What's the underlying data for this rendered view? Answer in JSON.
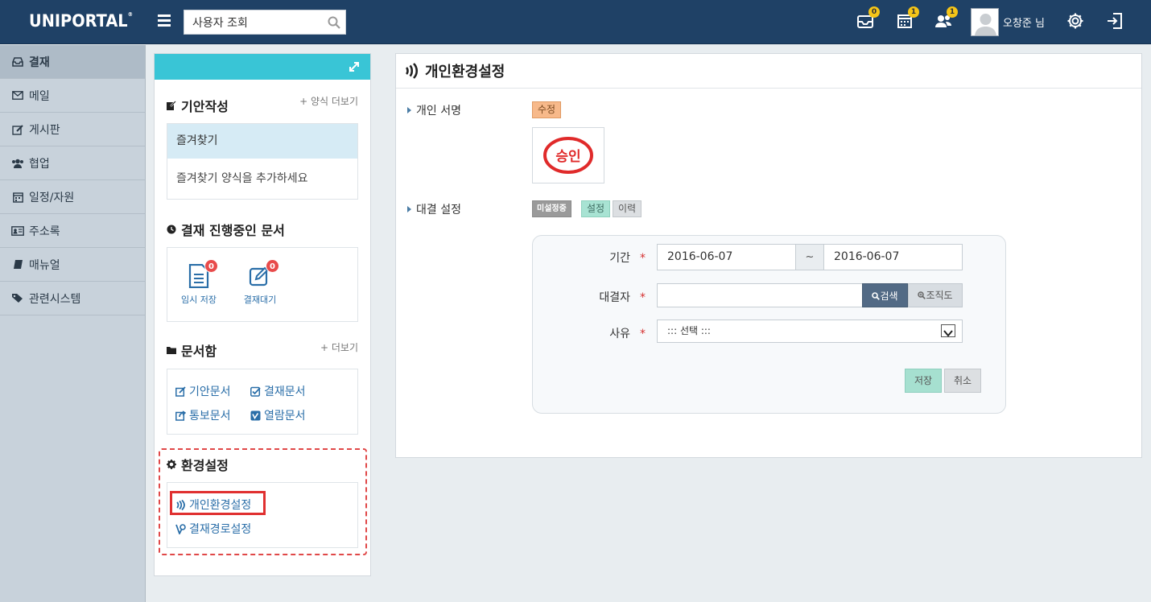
{
  "app": {
    "logo": "UNIPORTAL",
    "logo_mark": "®"
  },
  "search": {
    "value": "사용자 조회"
  },
  "header": {
    "badges": {
      "mail": "0",
      "calendar": "1",
      "people": "1"
    },
    "username": "오창준 님"
  },
  "nav": {
    "items": [
      {
        "label": "결재",
        "icon": "inbox-icon"
      },
      {
        "label": "메일",
        "icon": "envelope-icon"
      },
      {
        "label": "게시판",
        "icon": "edit-icon"
      },
      {
        "label": "협업",
        "icon": "users-icon"
      },
      {
        "label": "일정/자원",
        "icon": "calendar-icon"
      },
      {
        "label": "주소록",
        "icon": "address-card-icon"
      },
      {
        "label": "매뉴얼",
        "icon": "book-icon"
      },
      {
        "label": "관련시스템",
        "icon": "tags-icon"
      }
    ]
  },
  "sub": {
    "draft": {
      "title": "기안작성",
      "more": "+ 양식 더보기",
      "fav_head": "즐겨찾기",
      "fav_empty": "즐겨찾기 양식을 추가하세요"
    },
    "progress": {
      "title": "결재 진행중인 문서",
      "temp_label": "임시 저장",
      "temp_count": "0",
      "wait_label": "결재대기",
      "wait_count": "0"
    },
    "docs": {
      "title": "문서함",
      "more": "+ 더보기",
      "draft_docs": "기안문서",
      "approval_docs": "결재문서",
      "notice_docs": "통보문서",
      "read_docs": "열람문서"
    },
    "settings": {
      "title": "환경설정",
      "personal": "개인환경설정",
      "route": "결재경로설정"
    }
  },
  "main": {
    "title": "개인환경설정",
    "signature": {
      "label": "개인 서명",
      "edit_button": "수정",
      "stamp_text": "승인"
    },
    "delegate": {
      "label": "대결 설정",
      "status_badge": "미설정중",
      "set_button": "설정",
      "history_button": "이력",
      "period_label": "기간",
      "date_from": "2016-06-07",
      "tilde": "~",
      "date_to": "2016-06-07",
      "delegate_label": "대결자",
      "delegate_value": "",
      "search_button": "검색",
      "org_button": "조직도",
      "reason_label": "사유",
      "reason_selected": "::: 선택 :::",
      "save_button": "저장",
      "cancel_button": "취소",
      "required_mark": "*"
    }
  },
  "colors": {
    "topbar": "#1f4166",
    "accent": "#39c5d6",
    "highlight": "#e03030"
  }
}
